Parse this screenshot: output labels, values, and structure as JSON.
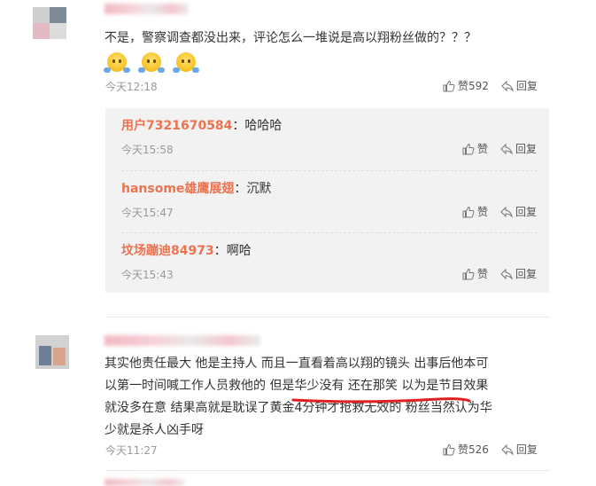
{
  "comments": [
    {
      "text": "不是，警察调查都没出来，评论怎么一堆说是高以翔粉丝做的？？？",
      "emoji_count": 3,
      "time": "今天12:18",
      "like_label": "赞592",
      "reply_label": "回复",
      "replies": [
        {
          "user": "用户7321670584",
          "colon": "：",
          "text": "哈哈哈",
          "time": "今天15:58",
          "like_label": "赞",
          "reply_label": "回复"
        },
        {
          "user": "hansome雄鹰展翅",
          "colon": "：",
          "text": "沉默",
          "time": "今天15:47",
          "like_label": "赞",
          "reply_label": "回复"
        },
        {
          "user": "坟场蹦迪84973",
          "colon": "：",
          "text": "啊哈",
          "time": "今天15:43",
          "like_label": "赞",
          "reply_label": "回复"
        }
      ]
    },
    {
      "text_lines": [
        "其实他责任最大 他是主持人 而且一直看着高以翔的镜头 出事后他本可",
        "以第一时间喊工作人员救他的 但是华少没有 还在那笑 以为是节目效果",
        "就没多在意 结果高就是耽误了黄金4分钟才抢救无效的 粉丝当然认为华",
        "少就是杀人凶手呀"
      ],
      "time": "今天11:27",
      "like_label": "赞526",
      "reply_label": "回复"
    }
  ],
  "colors": {
    "username": "#eb7350",
    "meta": "#999999",
    "text": "#333333",
    "reply_bg": "#f2f2f2",
    "annotation": "#e02020"
  }
}
